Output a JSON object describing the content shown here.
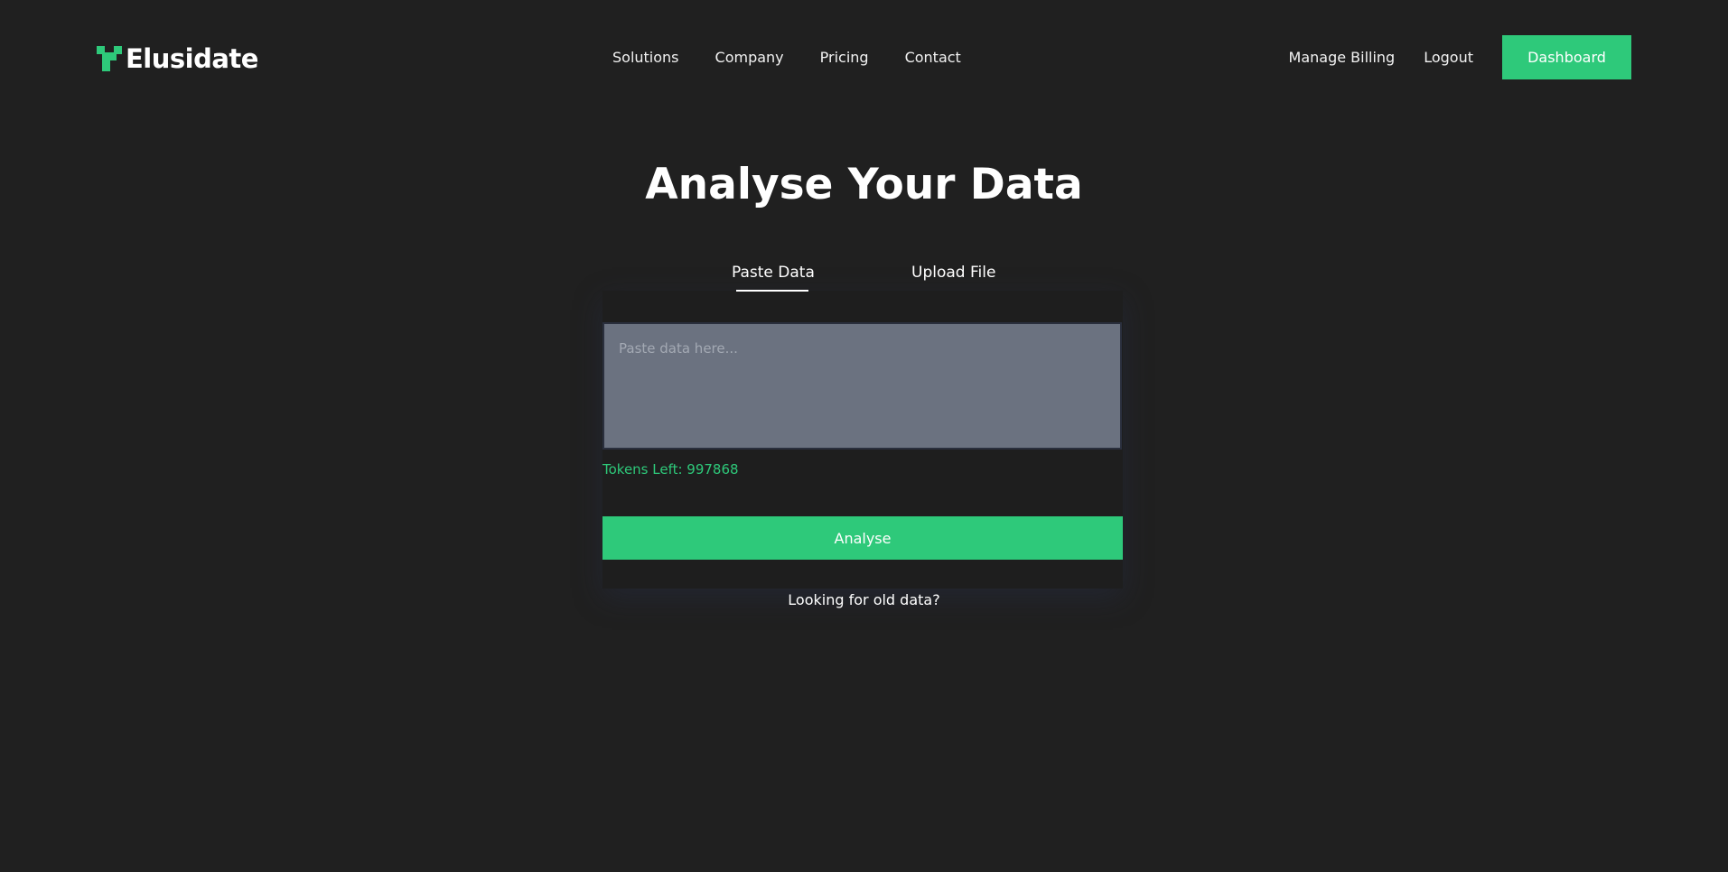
{
  "brand": {
    "name": "Elusidate",
    "logo_icon": "elusidate-logo-icon",
    "accent_color": "#2ec97a"
  },
  "nav": {
    "items": [
      {
        "label": "Solutions"
      },
      {
        "label": "Company"
      },
      {
        "label": "Pricing"
      },
      {
        "label": "Contact"
      }
    ],
    "manage_billing": "Manage Billing",
    "logout": "Logout",
    "dashboard": "Dashboard"
  },
  "main": {
    "title": "Analyse Your Data",
    "tabs": [
      {
        "label": "Paste Data",
        "active": true
      },
      {
        "label": "Upload File",
        "active": false
      }
    ],
    "input": {
      "placeholder": "Paste data here...",
      "value": ""
    },
    "tokens_label": "Tokens Left: 997868",
    "analyse_button": "Analyse",
    "old_data_link": "Looking for old data?"
  }
}
